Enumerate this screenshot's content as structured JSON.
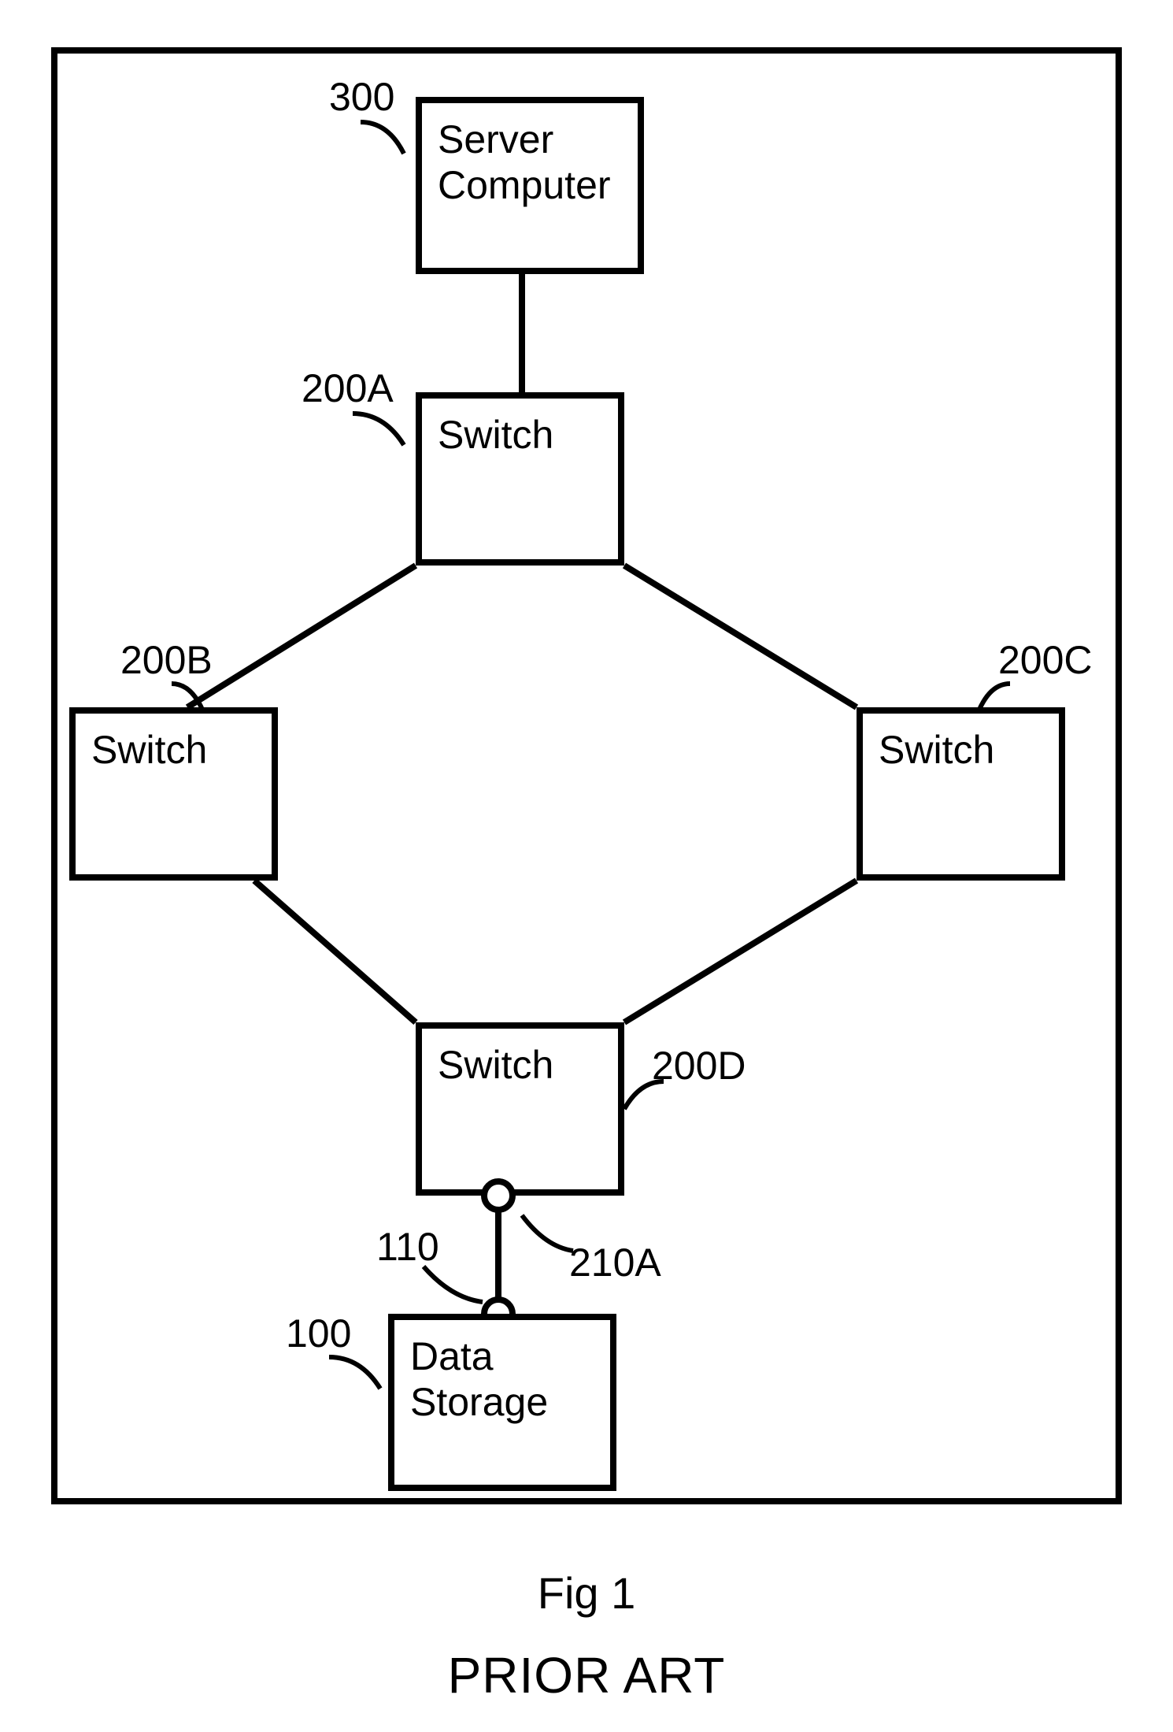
{
  "figure": {
    "label": "Fig 1",
    "subtitle": "PRIOR ART"
  },
  "nodes": {
    "server": {
      "label": "Server\nComputer",
      "ref": "300"
    },
    "switchA": {
      "label": "Switch",
      "ref": "200A"
    },
    "switchB": {
      "label": "Switch",
      "ref": "200B"
    },
    "switchC": {
      "label": "Switch",
      "ref": "200C"
    },
    "switchD": {
      "label": "Switch",
      "ref": "200D"
    },
    "storage": {
      "label": "Data\nStorage",
      "ref": "100"
    }
  },
  "ports": {
    "switchD_port": {
      "ref": "210A"
    },
    "storage_port": {
      "ref": "110"
    }
  }
}
